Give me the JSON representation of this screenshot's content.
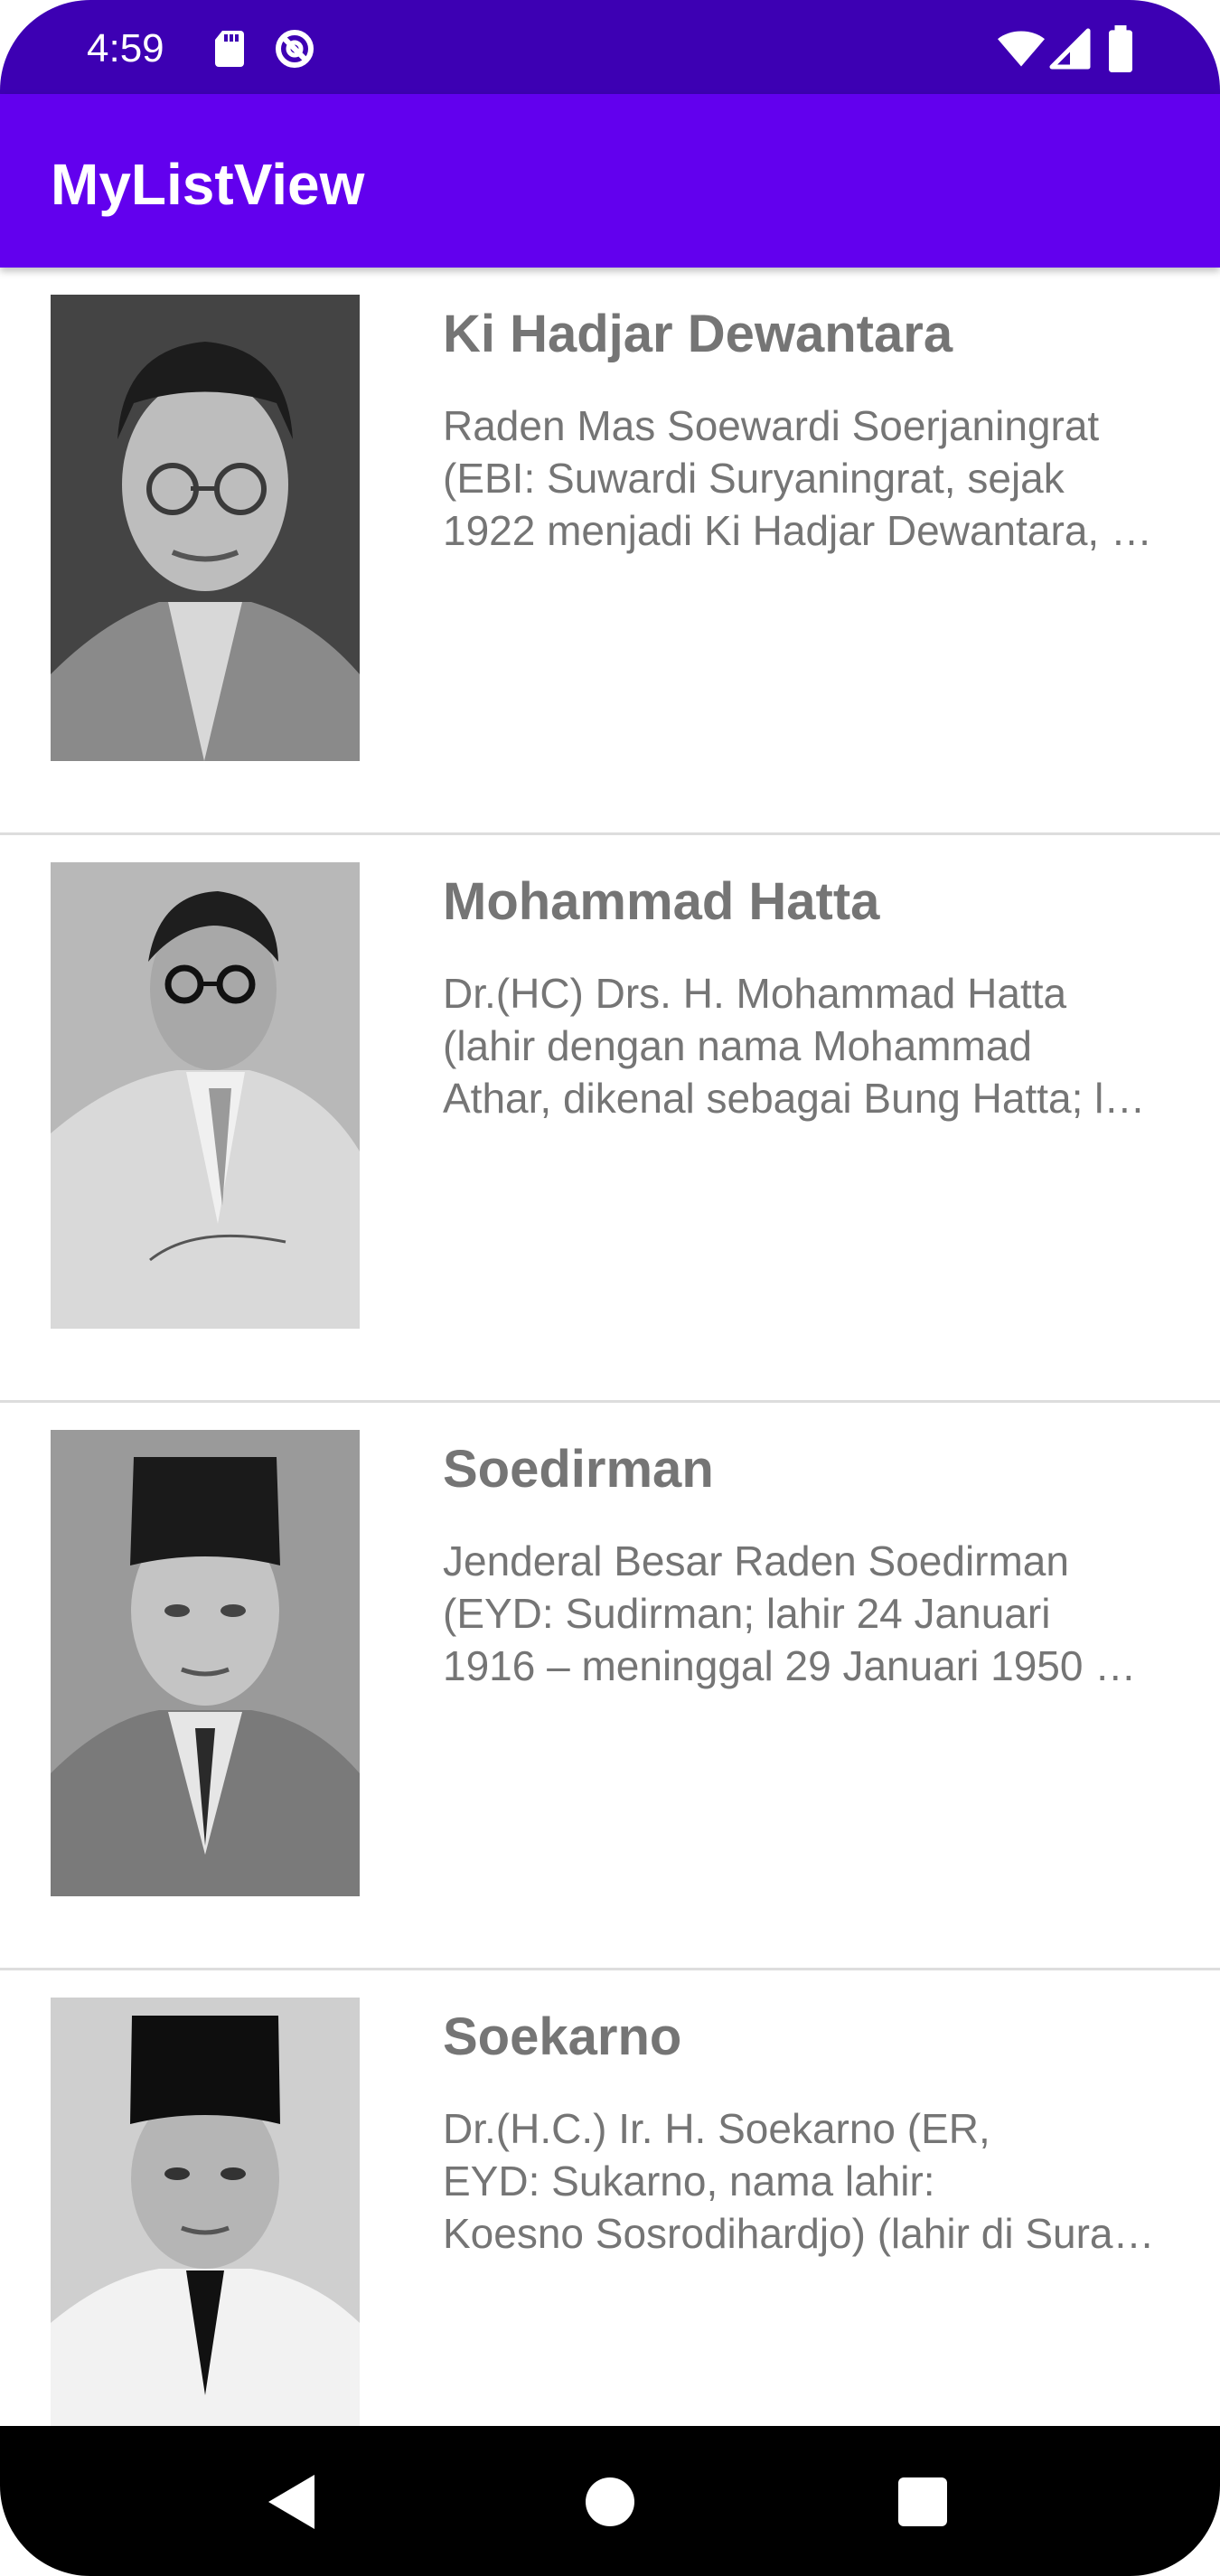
{
  "status_bar": {
    "time": "4:59",
    "icons": [
      "sd-card-icon",
      "do-not-disturb-icon",
      "wifi-icon",
      "signal-icon",
      "battery-icon"
    ],
    "color": "#3d00b3"
  },
  "app_bar": {
    "title": "MyListView",
    "color": "#6200ee"
  },
  "list": {
    "items": [
      {
        "name": "Ki Hadjar Dewantara",
        "desc_lines": [
          "Raden Mas Soewardi Soerjaningrat",
          "(EBI: Suwardi Suryaningrat, sejak",
          "1922 menjadi Ki Hadjar Dewantara, …"
        ]
      },
      {
        "name": "Mohammad Hatta",
        "desc_lines": [
          "Dr.(HC) Drs. H. Mohammad Hatta",
          "(lahir dengan nama Mohammad",
          "Athar, dikenal sebagai Bung Hatta; l…"
        ]
      },
      {
        "name": "Soedirman",
        "desc_lines": [
          "Jenderal Besar Raden Soedirman",
          "(EYD: Sudirman; lahir 24 Januari",
          "1916 – meninggal 29 Januari 1950 …"
        ]
      },
      {
        "name": "Soekarno",
        "desc_lines": [
          "Dr.(H.C.) Ir. H. Soekarno (ER,",
          "EYD: Sukarno, nama lahir:",
          "Koesno Sosrodihardjo) (lahir di Sura…"
        ]
      }
    ]
  },
  "nav_bar": {
    "buttons": [
      "back-icon",
      "home-icon",
      "recents-icon"
    ]
  }
}
